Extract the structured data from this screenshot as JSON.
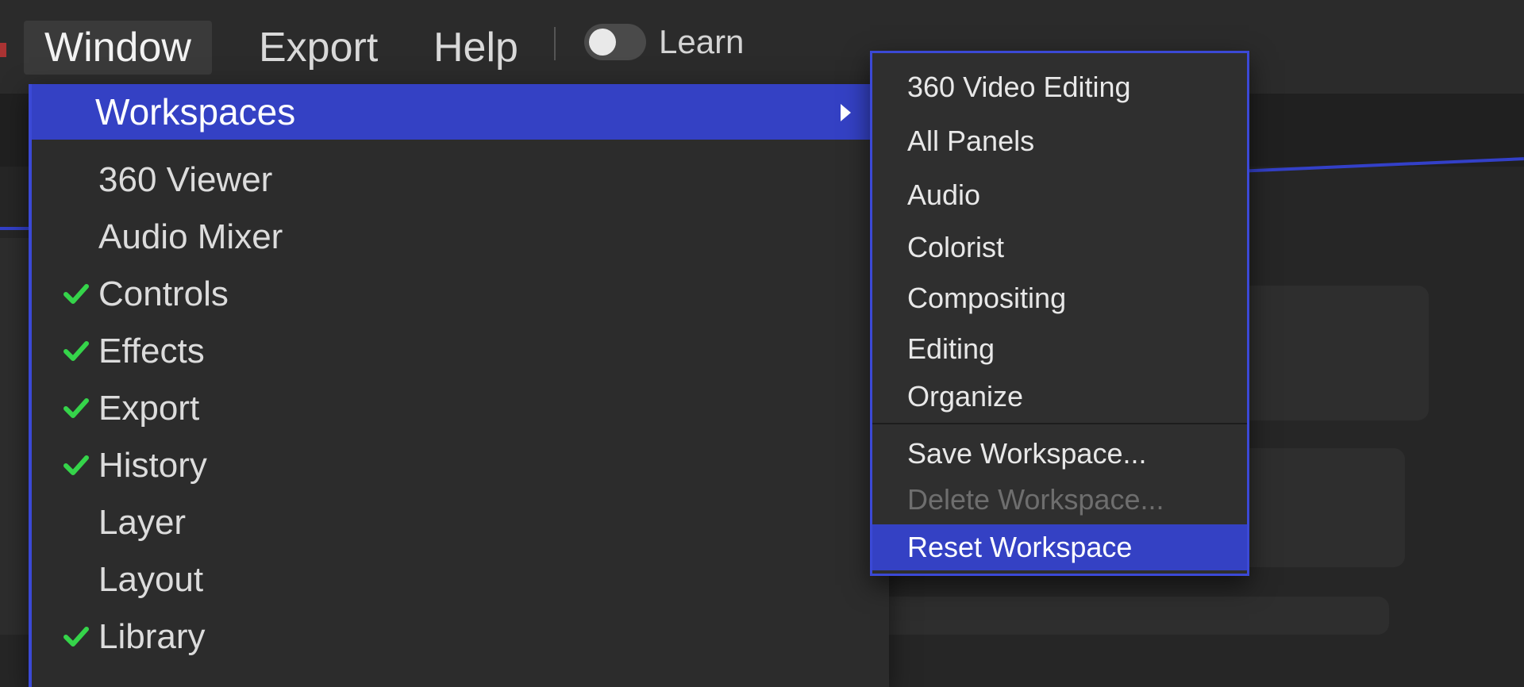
{
  "menubar": {
    "items": [
      {
        "label": "Window",
        "active": true
      },
      {
        "label": "Export",
        "active": false
      },
      {
        "label": "Help",
        "active": false
      }
    ],
    "learn_label": "Learn",
    "learn_toggle_on": false
  },
  "window_menu": {
    "highlight_item": "Workspaces",
    "items": [
      {
        "label": "Workspaces",
        "checked": false,
        "has_submenu": true
      },
      {
        "label": "360 Viewer",
        "checked": false
      },
      {
        "label": "Audio Mixer",
        "checked": false
      },
      {
        "label": "Controls",
        "checked": true
      },
      {
        "label": "Effects",
        "checked": true
      },
      {
        "label": "Export",
        "checked": true
      },
      {
        "label": "History",
        "checked": true
      },
      {
        "label": "Layer",
        "checked": false
      },
      {
        "label": "Layout",
        "checked": false
      },
      {
        "label": "Library",
        "checked": true
      }
    ]
  },
  "workspaces_submenu": {
    "items": [
      {
        "label": "360 Video Editing"
      },
      {
        "label": "All Panels"
      },
      {
        "label": "Audio"
      },
      {
        "label": "Colorist"
      },
      {
        "label": "Compositing"
      },
      {
        "label": "Editing"
      },
      {
        "label": "Organize"
      }
    ],
    "actions": [
      {
        "label": "Save Workspace...",
        "disabled": false,
        "highlight": false
      },
      {
        "label": "Delete Workspace...",
        "disabled": true,
        "highlight": false
      },
      {
        "label": "Reset Workspace",
        "disabled": false,
        "highlight": true
      }
    ]
  },
  "colors": {
    "accent": "#3441c4",
    "check": "#35d44a",
    "menu_bg": "#2c2c2c"
  }
}
